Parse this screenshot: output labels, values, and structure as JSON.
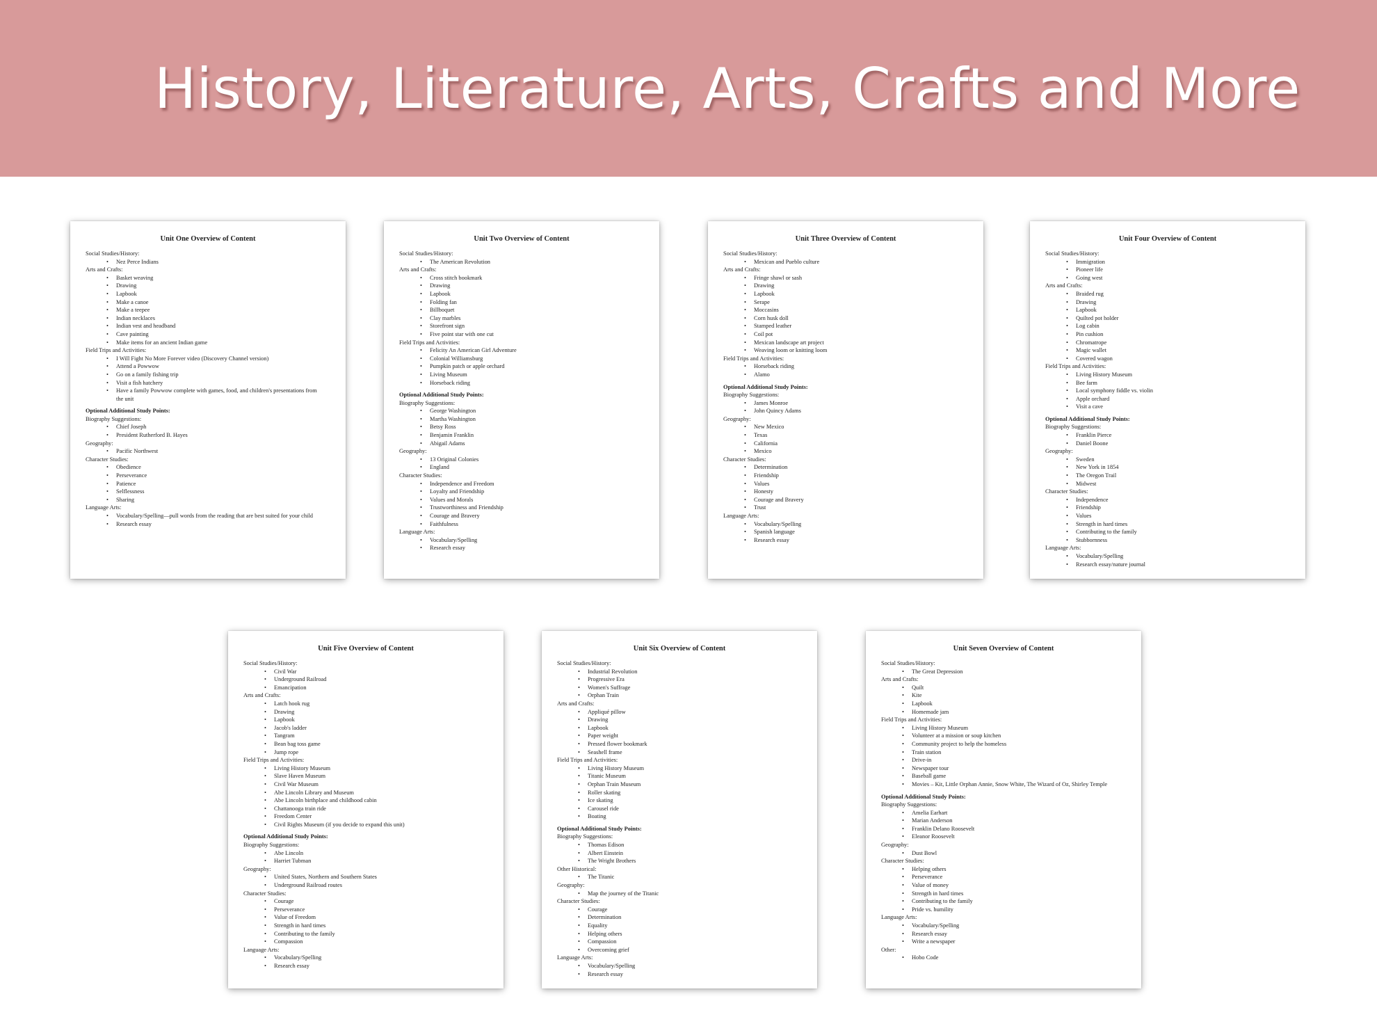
{
  "banner": {
    "title": "History, Literature, Arts, Crafts and More"
  },
  "pages": [
    {
      "title": "Unit One Overview of Content",
      "sections": [
        {
          "title": "Social Studies/History:",
          "items": [
            "Nez Perce Indians"
          ]
        },
        {
          "title": "Arts and Crafts:",
          "items": [
            "Basket weaving",
            "Drawing",
            "Lapbook",
            "Make a canoe",
            "Make a teepee",
            "Indian necklaces",
            "Indian vest and headband",
            "Cave painting",
            "Make items for an ancient Indian game"
          ]
        },
        {
          "title": "Field Trips and Activities:",
          "items": [
            "I Will Fight No More Forever video (Discovery Channel version)",
            "Attend a Powwow",
            "Go on a family fishing trip",
            "Visit a fish hatchery",
            "Have a family Powwow complete with games, food, and children's presentations from the unit"
          ]
        },
        {
          "title": "Optional Additional Study Points:",
          "bold": true,
          "items": []
        },
        {
          "title": "Biography Suggestions:",
          "items": [
            "Chief Joseph",
            "President Rutherford B. Hayes"
          ]
        },
        {
          "title": "Geography:",
          "items": [
            "Pacific Northwest"
          ]
        },
        {
          "title": "Character Studies:",
          "items": [
            "Obedience",
            "Perseverance",
            "Patience",
            "Selflessness",
            "Sharing"
          ]
        },
        {
          "title": "Language Arts:",
          "items": [
            "Vocabulary/Spelling—pull words from the reading that are best suited for your child",
            "Research essay"
          ]
        }
      ]
    },
    {
      "title": "Unit Two Overview of Content",
      "sections": [
        {
          "title": "Social Studies/History:",
          "items": [
            "The American Revolution"
          ]
        },
        {
          "title": "Arts and Crafts:",
          "items": [
            "Cross stitch bookmark",
            "Drawing",
            "Lapbook",
            "Folding fan",
            "Billboquet",
            "Clay marbles",
            "Storefront sign",
            "Five point star with one cut"
          ]
        },
        {
          "title": "Field Trips and Activities:",
          "items": [
            "Felicity An American Girl Adventure",
            "Colonial Williamsburg",
            "Pumpkin patch or apple orchard",
            "Living Museum",
            "Horseback riding"
          ]
        },
        {
          "title": "Optional Additional Study Points:",
          "bold": true,
          "items": []
        },
        {
          "title": "Biography Suggestions:",
          "items": [
            "George Washington",
            "Martha Washington",
            "Betsy Ross",
            "Benjamin Franklin",
            "Abigail Adams"
          ]
        },
        {
          "title": "Geography:",
          "items": [
            "13 Original Colonies",
            "England"
          ]
        },
        {
          "title": "Character Studies:",
          "items": [
            "Independence and Freedom",
            "Loyalty and Friendship",
            "Values and Morals",
            "Trustworthiness and Friendship",
            "Courage and Bravery",
            "Faithfulness"
          ]
        },
        {
          "title": "Language Arts:",
          "items": [
            "Vocabulary/Spelling",
            "Research essay"
          ]
        }
      ]
    },
    {
      "title": "Unit Three Overview of Content",
      "sections": [
        {
          "title": "Social Studies/History:",
          "items": [
            "Mexican and Pueblo culture"
          ]
        },
        {
          "title": "Arts and Crafts:",
          "items": [
            "Fringe shawl or sash",
            "Drawing",
            "Lapbook",
            "Serape",
            "Moccasins",
            "Corn husk doll",
            "Stamped leather",
            "Coil pot",
            "Mexican landscape art project",
            "Weaving loom or knitting loom"
          ]
        },
        {
          "title": "Field Trips and Activities:",
          "items": [
            "Horseback riding",
            "Alamo"
          ]
        },
        {
          "title": "Optional Additional Study Points:",
          "bold": true,
          "items": []
        },
        {
          "title": "Biography Suggestions:",
          "items": [
            "James Monroe",
            "John Quincy Adams"
          ]
        },
        {
          "title": "Geography:",
          "items": [
            "New Mexico",
            "Texas",
            "California",
            "Mexico"
          ]
        },
        {
          "title": "Character Studies:",
          "items": [
            "Determination",
            "Friendship",
            "Values",
            "Honesty",
            "Courage and Bravery",
            "Trust"
          ]
        },
        {
          "title": "Language Arts:",
          "items": [
            "Vocabulary/Spelling",
            "Spanish language",
            "Research essay"
          ]
        }
      ]
    },
    {
      "title": "Unit Four Overview of Content",
      "sections": [
        {
          "title": "Social Studies/History:",
          "items": [
            "Immigration",
            "Pioneer life",
            "Going west"
          ]
        },
        {
          "title": "Arts and Crafts:",
          "items": [
            "Braided rug",
            "Drawing",
            "Lapbook",
            "Quilted pot holder",
            "Log cabin",
            "Pin cushion",
            "Chromatrope",
            "Magic wallet",
            "Covered wagon"
          ]
        },
        {
          "title": "Field Trips and Activities:",
          "items": [
            "Living History Museum",
            "Bee farm",
            "Local symphony fiddle vs. violin",
            "Apple orchard",
            "Visit a cave"
          ]
        },
        {
          "title": "Optional Additional Study Points:",
          "bold": true,
          "items": []
        },
        {
          "title": "Biography Suggestions:",
          "items": [
            "Franklin Pierce",
            "Daniel Boone"
          ]
        },
        {
          "title": "Geography:",
          "items": [
            "Sweden",
            "New York in 1854",
            "The Oregon Trail",
            "Midwest"
          ]
        },
        {
          "title": "Character Studies:",
          "items": [
            "Independence",
            "Friendship",
            "Values",
            "Strength in hard times",
            "Contributing to the family",
            "Stubbornness"
          ]
        },
        {
          "title": "Language Arts:",
          "items": [
            "Vocabulary/Spelling",
            "Research essay/nature journal"
          ]
        }
      ]
    },
    {
      "title": "Unit Five Overview of Content",
      "sections": [
        {
          "title": "Social Studies/History:",
          "items": [
            "Civil War",
            "Underground Railroad",
            "Emancipation"
          ]
        },
        {
          "title": "Arts and Crafts:",
          "items": [
            "Latch hook rug",
            "Drawing",
            "Lapbook",
            "Jacob's ladder",
            "Tangram",
            "Bean bag toss game",
            "Jump rope"
          ]
        },
        {
          "title": "Field Trips and Activities:",
          "items": [
            "Living History Museum",
            "Slave Haven Museum",
            "Civil War Museum",
            "Abe Lincoln Library and Museum",
            "Abe Lincoln birthplace and childhood cabin",
            "Chattanooga train ride",
            "Freedom Center",
            "Civil Rights Museum (if you decide to expand this unit)"
          ]
        },
        {
          "title": "Optional Additional Study Points:",
          "bold": true,
          "items": []
        },
        {
          "title": "Biography Suggestions:",
          "items": [
            "Abe Lincoln",
            "Harriet Tubman"
          ]
        },
        {
          "title": "Geography:",
          "items": [
            "United States, Northern and Southern States",
            "Underground Railroad routes"
          ]
        },
        {
          "title": "Character Studies:",
          "items": [
            "Courage",
            "Perseverance",
            "Value of Freedom",
            "Strength in hard times",
            "Contributing to the family",
            "Compassion"
          ]
        },
        {
          "title": "Language Arts:",
          "items": [
            "Vocabulary/Spelling",
            "Research essay"
          ]
        }
      ]
    },
    {
      "title": "Unit Six Overview of Content",
      "sections": [
        {
          "title": "Social Studies/History:",
          "items": [
            "Industrial Revolution",
            "Progressive Era",
            "Women's Suffrage",
            "Orphan Train"
          ]
        },
        {
          "title": "Arts and Crafts:",
          "items": [
            "Appliqué pillow",
            "Drawing",
            "Lapbook",
            "Paper weight",
            "Pressed flower bookmark",
            "Seashell frame"
          ]
        },
        {
          "title": "Field Trips and Activities:",
          "items": [
            "Living History Museum",
            "Titanic Museum",
            "Orphan Train Museum",
            "Roller skating",
            "Ice skating",
            "Carousel ride",
            "Boating"
          ]
        },
        {
          "title": "Optional Additional Study Points:",
          "bold": true,
          "items": []
        },
        {
          "title": "Biography Suggestions:",
          "items": [
            "Thomas Edison",
            "Albert Einstein",
            "The Wright Brothers"
          ]
        },
        {
          "title": "Other Historical:",
          "items": [
            "The Titanic"
          ]
        },
        {
          "title": "Geography:",
          "items": [
            "Map the journey of the Titanic"
          ]
        },
        {
          "title": "Character Studies:",
          "items": [
            "Courage",
            "Determination",
            "Equality",
            "Helping others",
            "Compassion",
            "Overcoming grief"
          ]
        },
        {
          "title": "Language Arts:",
          "items": [
            "Vocabulary/Spelling",
            "Research essay"
          ]
        }
      ]
    },
    {
      "title": "Unit Seven Overview of Content",
      "sections": [
        {
          "title": "Social Studies/History:",
          "items": [
            "The Great Depression"
          ]
        },
        {
          "title": "Arts and Crafts:",
          "items": [
            "Quilt",
            "Kite",
            "Lapbook",
            "Homemade jam"
          ]
        },
        {
          "title": "Field Trips and Activities:",
          "items": [
            "Living History Museum",
            "Volunteer at a mission or soup kitchen",
            "Community project to help the homeless",
            "Train station",
            "Drive-in",
            "Newspaper tour",
            "Baseball game",
            "Movies – Kit, Little Orphan Annie, Snow White, The Wizard of Oz, Shirley Temple"
          ]
        },
        {
          "title": "Optional Additional Study Points:",
          "bold": true,
          "items": []
        },
        {
          "title": "Biography Suggestions:",
          "items": [
            "Amelia Earhart",
            "Marian Anderson",
            "Franklin Delano Roosevelt",
            "Eleanor Roosevelt"
          ]
        },
        {
          "title": "Geography:",
          "items": [
            "Dust Bowl"
          ]
        },
        {
          "title": "Character Studies:",
          "items": [
            "Helping others",
            "Perseverance",
            "Value of money",
            "Strength in hard times",
            "Contributing to the family",
            "Pride vs. humility"
          ]
        },
        {
          "title": "Language Arts:",
          "items": [
            "Vocabulary/Spelling",
            "Research essay",
            "Write a newspaper"
          ]
        },
        {
          "title": "Other:",
          "items": [
            "Hobo Code"
          ]
        }
      ]
    }
  ]
}
